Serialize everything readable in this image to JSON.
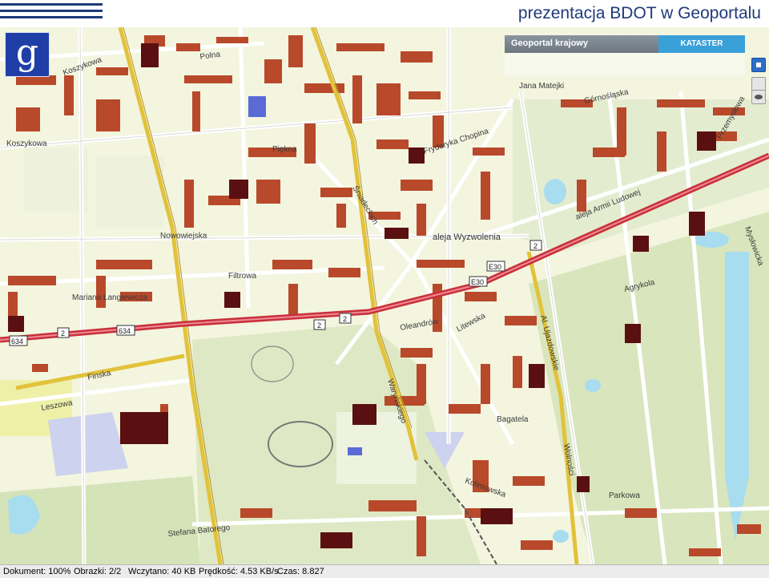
{
  "header": {
    "title": "prezentacja BDOT w Geoportalu"
  },
  "logo": {
    "glyph": "g",
    "icon": "geoportal-logo-icon"
  },
  "toolbar": {
    "label": "Geoportal krajowy",
    "button": "KATASTER"
  },
  "controls": [
    {
      "icon": "layers-icon"
    },
    {
      "icon": "pan-icon"
    },
    {
      "icon": "eye-icon"
    }
  ],
  "map": {
    "street_labels": [
      "Koszykowa",
      "Nowowiejska",
      "Filtrowa",
      "Mariana Langiewicza",
      "Finska",
      "Leszowa",
      "Stefana Batorego",
      "Piękna",
      "Fryderyka Chopina",
      "aleja Wyzwolenia",
      "Agrykola",
      "Bagatela",
      "Kolimowska",
      "Parkowa",
      "Jana Matejki",
      "Górnośląska",
      "aleja Armii Ludowej",
      "Oleandrów",
      "Litewska",
      "Przemysłowa",
      "Mysłowicka",
      "Al. Ujazdowskie",
      "Koszykowa",
      "Polna",
      "Śniadeckich",
      "Waryńskiego",
      "Wolności"
    ],
    "road_shields": [
      "2",
      "2",
      "2",
      "634",
      "634",
      "E30",
      "E30",
      "2"
    ]
  },
  "status": {
    "document": "Dokument: 100%",
    "images": "Obrazki: 2/2",
    "loaded": "Wczytano: 40 KB",
    "speed": "Prędkość: 4.53 KB/s",
    "time": "Czas: 8.827"
  },
  "colors": {
    "building": "#b8492a",
    "building_dark": "#5a1010",
    "park": "#dfe8c4",
    "major_road": "#e2c23a",
    "express_road": "#c8303a",
    "water": "#9fd6ee",
    "title": "#1f3a7a"
  }
}
